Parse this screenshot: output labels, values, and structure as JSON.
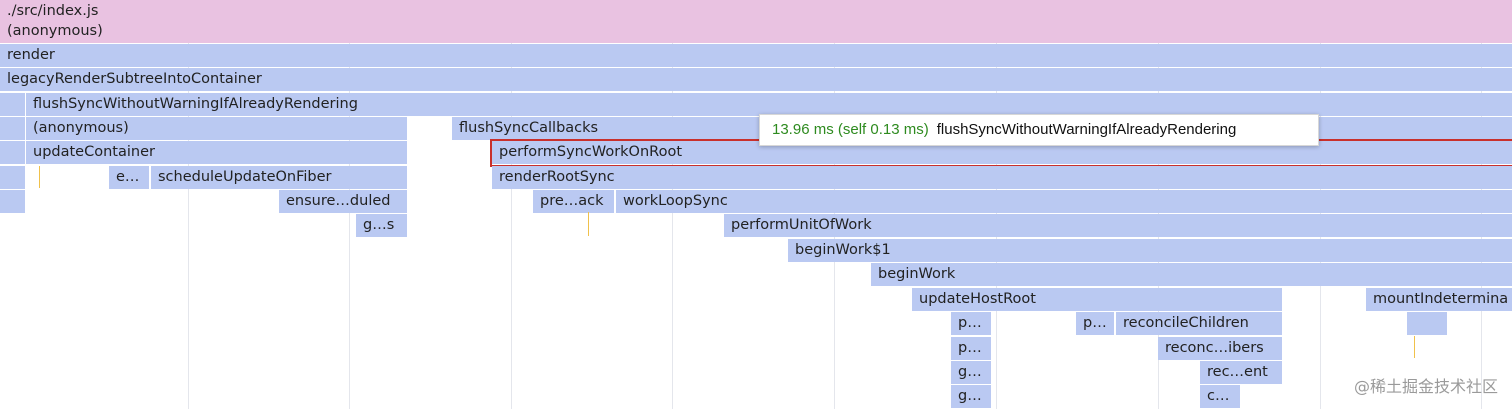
{
  "flame": {
    "rows": [
      [
        "./src/index.js"
      ],
      [
        "(anonymous)"
      ],
      [
        "render"
      ],
      [
        "legacyRenderSubtreeIntoContainer"
      ],
      [
        "flushSyncWithoutWarningIfAlreadyRendering"
      ],
      [
        "(anonymous)",
        "flushSyncCallbacks"
      ],
      [
        "updateContainer",
        "performSyncWorkOnRoot"
      ],
      [
        "e…",
        "scheduleUpdateOnFiber",
        "renderRootSync"
      ],
      [
        "ensure…duled",
        "pre…ack",
        "workLoopSync"
      ],
      [
        "g…s",
        "performUnitOfWork"
      ],
      [
        "beginWork$1"
      ],
      [
        "beginWork"
      ],
      [
        "updateHostRoot",
        "mountIndetermina"
      ],
      [
        "p…",
        "p…",
        "reconcileChildren"
      ],
      [
        "p…",
        "reconc…ibers"
      ],
      [
        "g…",
        "rec…ent"
      ],
      [
        "g…",
        "c…"
      ]
    ]
  },
  "tooltip": {
    "time": "13.96 ms (self 0.13 ms)",
    "function": "flushSyncWithoutWarningIfAlreadyRendering"
  },
  "watermark": "@稀土掘金技术社区",
  "colors": {
    "bundle_frame": "#e9c2e1",
    "react_frame": "#bac9f2",
    "selection_border": "#c9302c",
    "tooltip_time": "#2e8b1f"
  }
}
